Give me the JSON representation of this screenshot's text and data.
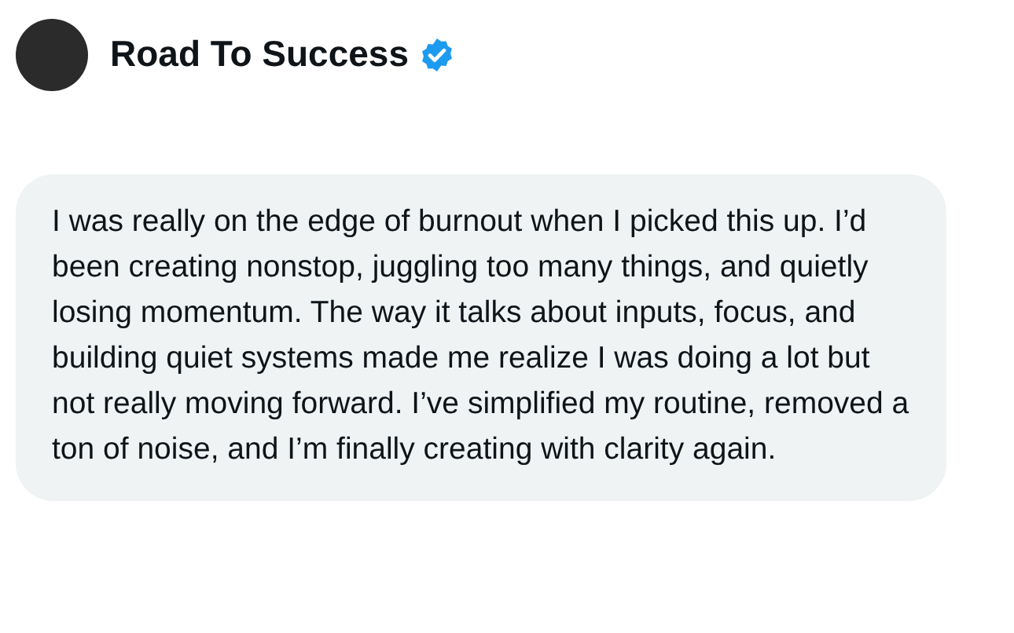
{
  "author": {
    "name": "Road To Success",
    "verified": true
  },
  "message": {
    "text": "I was really on the edge of burnout when I picked this up. I’d been creating nonstop, juggling too many things, and quietly losing momentum. The way it talks about inputs, focus, and building quiet systems made me realize I was doing a lot but not really moving forward. I’ve simplified my routine, removed a ton of noise, and I’m finally creating with clarity again."
  }
}
